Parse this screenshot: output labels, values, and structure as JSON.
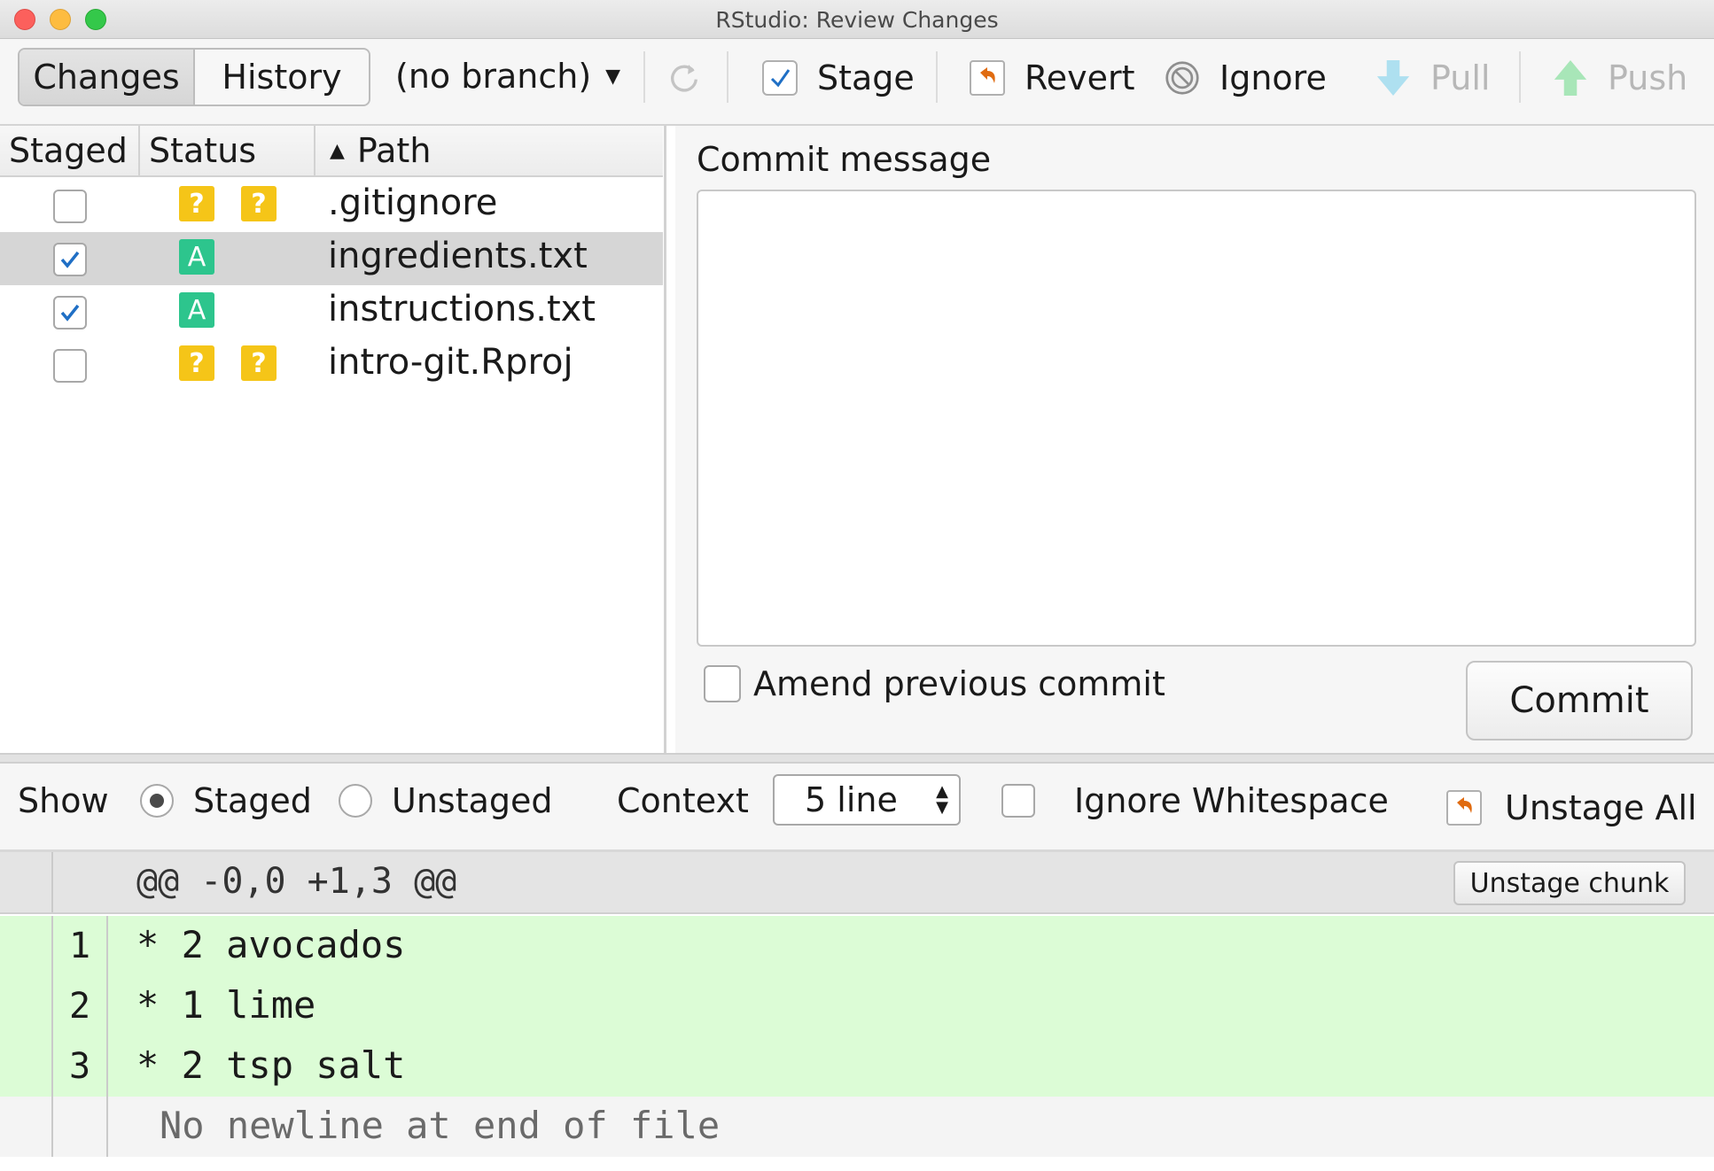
{
  "window": {
    "title": "RStudio: Review Changes"
  },
  "toolbar": {
    "tabs": [
      {
        "label": "Changes",
        "active": true
      },
      {
        "label": "History",
        "active": false
      }
    ],
    "branch": "(no branch)",
    "stage_label": "Stage",
    "revert_label": "Revert",
    "ignore_label": "Ignore",
    "pull_label": "Pull",
    "push_label": "Push"
  },
  "files": {
    "columns": {
      "staged": "Staged",
      "status": "Status",
      "path": "Path"
    },
    "rows": [
      {
        "path": ".gitignore",
        "staged": false,
        "status": [
          "?",
          "?"
        ],
        "selected": false
      },
      {
        "path": "ingredients.txt",
        "staged": true,
        "status": [
          "A"
        ],
        "selected": true
      },
      {
        "path": "instructions.txt",
        "staged": true,
        "status": [
          "A"
        ],
        "selected": false
      },
      {
        "path": "intro-git.Rproj",
        "staged": false,
        "status": [
          "?",
          "?"
        ],
        "selected": false
      }
    ]
  },
  "commit": {
    "label": "Commit message",
    "message": "",
    "amend_label": "Amend previous commit",
    "amend_checked": false,
    "button_label": "Commit"
  },
  "diff_options": {
    "show_label": "Show",
    "staged_label": "Staged",
    "unstaged_label": "Unstaged",
    "show_selected": "Staged",
    "context_label": "Context",
    "context_value": "5 line",
    "ignore_ws_label": "Ignore Whitespace",
    "ignore_ws_checked": false,
    "unstage_all_label": "Unstage All"
  },
  "diff": {
    "chunk_header": "@@ -0,0 +1,3 @@",
    "chunk_button": "Unstage chunk",
    "lines": [
      {
        "num": "1",
        "text": "* 2 avocados"
      },
      {
        "num": "2",
        "text": "* 1 lime"
      },
      {
        "num": "3",
        "text": "* 2 tsp salt"
      }
    ],
    "footer_note": "No newline at end of file"
  },
  "colors": {
    "added_bg": "#dcfcd6",
    "status_untracked": "#f5c518",
    "status_added": "#2dc58d",
    "check_blue": "#1f6fc5",
    "selected_row": "#d6d6d6"
  }
}
